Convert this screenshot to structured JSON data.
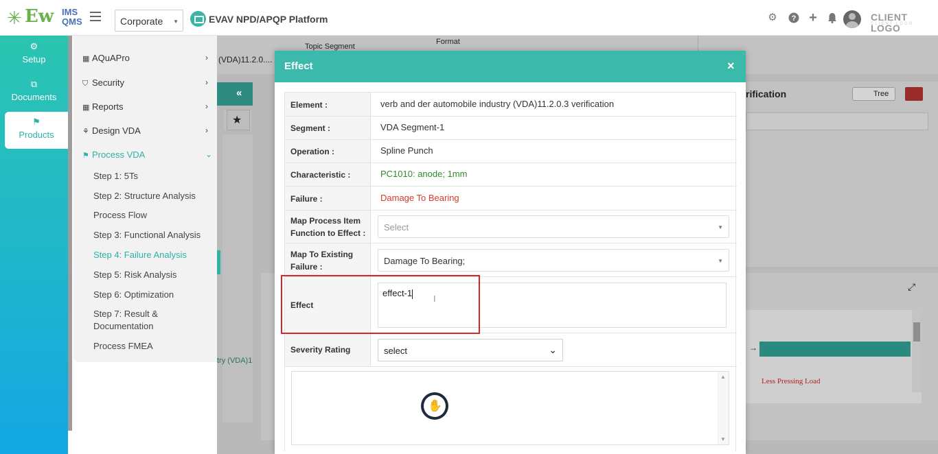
{
  "topbar": {
    "logo_main": "Ew",
    "logo_ims": "IMS",
    "logo_qms": "QMS",
    "company": "Corporate",
    "platform_title": "EVAV NPD/APQP Platform",
    "client_logo": "CLIENT LOGO",
    "client_logo_sub": "CLIENT LOGO"
  },
  "leftnav": [
    {
      "label": "Setup",
      "icon": "gears-icon"
    },
    {
      "label": "Documents",
      "icon": "copy-icon"
    },
    {
      "label": "Products",
      "icon": "flag-icon",
      "active": true
    }
  ],
  "menu": {
    "items": [
      {
        "label": "AQuAPro"
      },
      {
        "label": "Security"
      },
      {
        "label": "Reports"
      },
      {
        "label": "Design VDA"
      },
      {
        "label": "Process VDA"
      }
    ],
    "subitems": [
      {
        "label": "Step 1: 5Ts"
      },
      {
        "label": "Step 2: Structure Analysis"
      },
      {
        "label": "Process Flow"
      },
      {
        "label": "Step 3: Functional Analysis"
      },
      {
        "label": "Step 4: Failure Analysis"
      },
      {
        "label": "Step 5: Risk Analysis"
      },
      {
        "label": "Step 6: Optimization"
      },
      {
        "label": "Step 7: Result & Documentation"
      },
      {
        "label": "Process FMEA"
      }
    ]
  },
  "background": {
    "topic_segment": "Topic Segment",
    "format": "Format",
    "vda_crumb": "(VDA)11.2.0....",
    "verification": "rification",
    "tree_toggle": "Tree",
    "vda_side": "try (VDA)1",
    "less_pressing_load": "Less Pressing Load"
  },
  "modal": {
    "title": "Effect",
    "close": "×",
    "fields": {
      "element_label": "Element :",
      "element_value": "verb and der automobile industry (VDA)11.2.0.3 verification",
      "segment_label": "Segment :",
      "segment_value": "VDA Segment-1",
      "operation_label": "Operation :",
      "operation_value": "Spline Punch",
      "characteristic_label": "Characteristic :",
      "characteristic_value": "PC1010: anode; 1mm",
      "failure_label": "Failure :",
      "failure_value": "Damage To Bearing",
      "map_function_label_1": "Map Process Item",
      "map_function_label_2": "Function to Effect :",
      "map_function_placeholder": "Select",
      "map_failure_label_1": "Map To Existing",
      "map_failure_label_2": "Failure :",
      "map_failure_value": "Damage To Bearing;",
      "effect_label": "Effect",
      "effect_value": "effect-1",
      "severity_label": "Severity Rating",
      "severity_value": "select"
    }
  },
  "colors": {
    "teal": "#3bb9aa",
    "green_text": "#2e8b2e",
    "red_text": "#d93a2b",
    "highlight": "#d42626"
  }
}
